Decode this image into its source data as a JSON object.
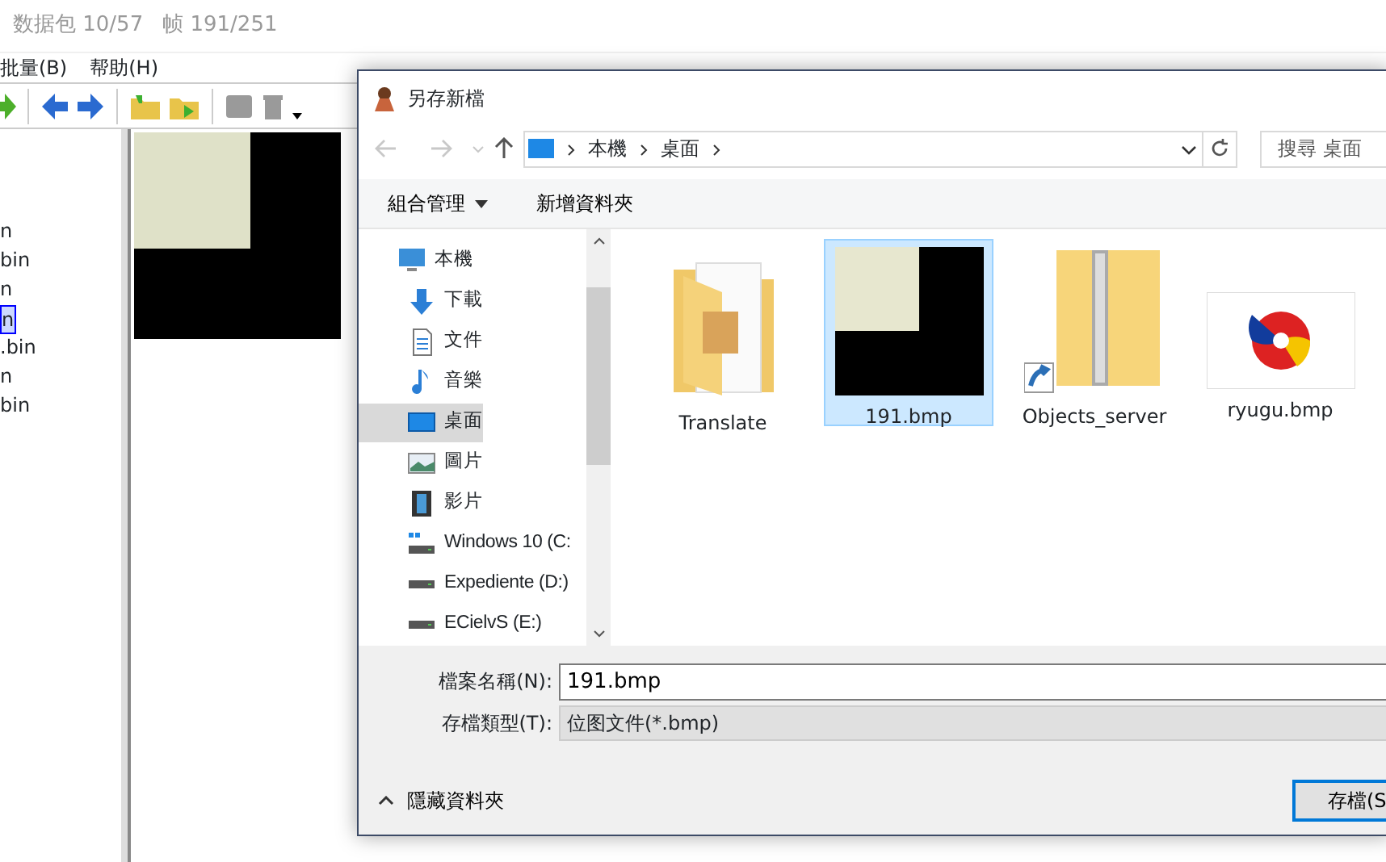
{
  "app": {
    "title": [
      "数据包 10/57",
      "帧 191/251"
    ],
    "menu": [
      "批量(B)",
      "帮助(H)"
    ],
    "file_list": [
      {
        "label": "n",
        "selected": false
      },
      {
        "label": "bin",
        "selected": false
      },
      {
        "label": "n",
        "selected": false
      },
      {
        "label": "n",
        "selected": true
      },
      {
        "label": ".bin",
        "selected": false
      },
      {
        "label": "n",
        "selected": false
      },
      {
        "label": "bin",
        "selected": false
      }
    ]
  },
  "dialog": {
    "title": "另存新檔",
    "breadcrumb": [
      "本機",
      "桌面"
    ],
    "search": {
      "placeholder": "搜尋 桌面"
    },
    "commands": [
      {
        "label": "組合管理",
        "kind": "menu"
      },
      {
        "label": "新增資料夾",
        "kind": "plain"
      }
    ],
    "nav": [
      {
        "label": "本機",
        "kind": "pc",
        "selected": false,
        "children": [
          {
            "label": "下載",
            "kind": "download",
            "selected": false
          },
          {
            "label": "文件",
            "kind": "document",
            "selected": false
          },
          {
            "label": "音樂",
            "kind": "music",
            "selected": false
          },
          {
            "label": "桌面",
            "kind": "desktop",
            "selected": true
          },
          {
            "label": "圖片",
            "kind": "pictures",
            "selected": false
          },
          {
            "label": "影片",
            "kind": "video",
            "selected": false
          },
          {
            "label": "Windows 10 (C:",
            "kind": "system-drive",
            "selected": false
          },
          {
            "label": "Expediente (D:)",
            "kind": "drive",
            "selected": false
          },
          {
            "label": "ECielvS (E:)",
            "kind": "drive",
            "selected": false
          }
        ]
      }
    ],
    "files": [
      {
        "label": "Translate",
        "kind": "folder",
        "selected": false
      },
      {
        "label": "191.bmp",
        "kind": "bitmap",
        "selected": true
      },
      {
        "label": "Objects_server",
        "kind": "zip-shortcut",
        "selected": false
      },
      {
        "label": "ryugu.bmp",
        "kind": "logo-bitmap",
        "selected": false
      }
    ],
    "filename": {
      "label": "檔案名稱(N):",
      "value": "191.bmp"
    },
    "filetype": {
      "label": "存檔類型(T):",
      "value": "位图文件(*.bmp)"
    },
    "hide_folders": "隱藏資料夾",
    "save": "存檔(S"
  }
}
